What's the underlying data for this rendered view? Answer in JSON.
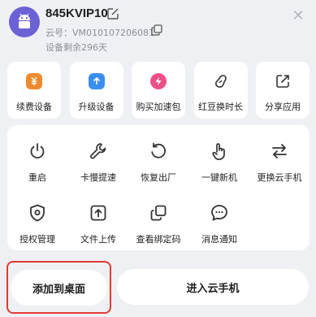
{
  "header": {
    "device_name": "845KVIP10",
    "cloud_id": "云号：VM010107206081",
    "remaining": "设备剩余296天",
    "close_symbol": "✕"
  },
  "quick_actions": [
    {
      "label": "续费设备",
      "icon": "renew-icon",
      "color": "#f08a2e"
    },
    {
      "label": "升级设备",
      "icon": "upgrade-icon",
      "color": "#3a8ef0"
    },
    {
      "label": "购买加速包",
      "icon": "boost-icon",
      "color": "#f04f86"
    },
    {
      "label": "红豆换时长",
      "icon": "bean-icon",
      "color": ""
    },
    {
      "label": "分享应用",
      "icon": "share-icon",
      "color": ""
    }
  ],
  "tools": [
    {
      "label": "重启",
      "icon": "power-icon"
    },
    {
      "label": "卡慢提速",
      "icon": "wrench-icon"
    },
    {
      "label": "恢复出厂",
      "icon": "reset-icon"
    },
    {
      "label": "一键新机",
      "icon": "tap-hand-icon"
    },
    {
      "label": "更换云手机",
      "icon": "swap-icon"
    },
    {
      "label": "授权管理",
      "icon": "shield-icon"
    },
    {
      "label": "文件上传",
      "icon": "upload-icon"
    },
    {
      "label": "查看绑定码",
      "icon": "copy-code-icon"
    },
    {
      "label": "消息通知",
      "icon": "message-icon"
    }
  ],
  "buttons": {
    "add_to_desktop": "添加到桌面",
    "enter_cloud_phone": "进入云手机"
  },
  "colors": {
    "background": "#eef0f4",
    "highlight_border": "#e03b35",
    "avatar": "#6b62d6"
  }
}
